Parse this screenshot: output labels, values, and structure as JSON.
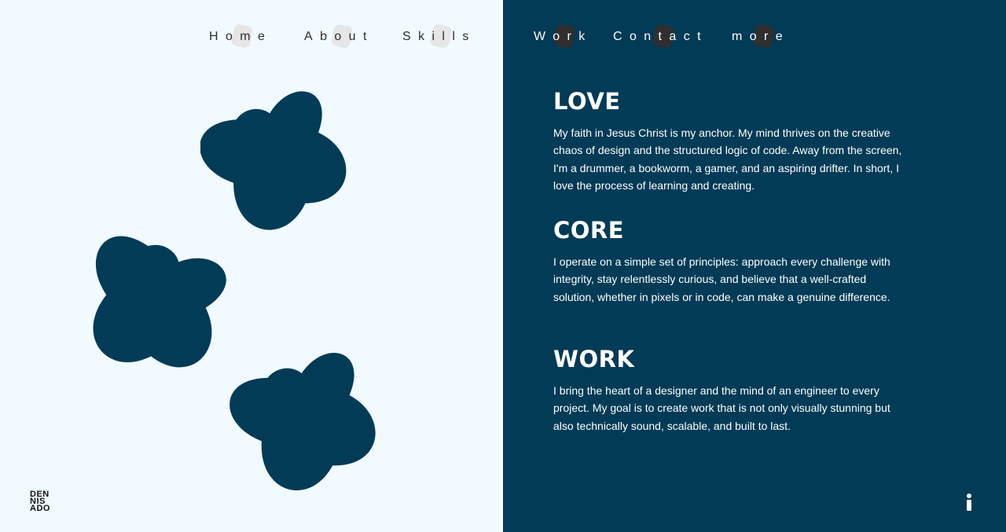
{
  "nav": {
    "items": [
      {
        "label": "Home"
      },
      {
        "label": "About"
      },
      {
        "label": "Skills"
      },
      {
        "label": "Work"
      },
      {
        "label": "Contact"
      },
      {
        "label": "more"
      }
    ]
  },
  "logo": {
    "line1": "DEN",
    "line2": "NIS",
    "line3": "ADO"
  },
  "sections": [
    {
      "heading": "LOVE",
      "body": "My faith in Jesus Christ is my anchor. My mind thrives on the creative chaos of design and the structured logic of code. Away from the screen, I'm a drummer, a bookworm, a gamer, and an aspiring drifter. In short, I love the process of learning and creating."
    },
    {
      "heading": "CORE",
      "body": "I operate on a simple set of principles: approach every challenge with integrity, stay relentlessly curious, and believe that a well-crafted solution, whether in pixels or in code, can make a genuine difference."
    },
    {
      "heading": "WORK",
      "body": "I bring the heart of a designer and the mind of an engineer to every project. My goal is to create work that is not only visually stunning but also technically sound, scalable, and built to last."
    }
  ],
  "colors": {
    "left_bg": "#f1fbff",
    "right_bg": "#013b56",
    "shape_fill": "#013b56",
    "text_light": "#ffffff",
    "text_dark": "#2e2e2e"
  },
  "icons": {
    "info": "info-icon",
    "decor_shapes": "four-petal-blob-shape"
  }
}
